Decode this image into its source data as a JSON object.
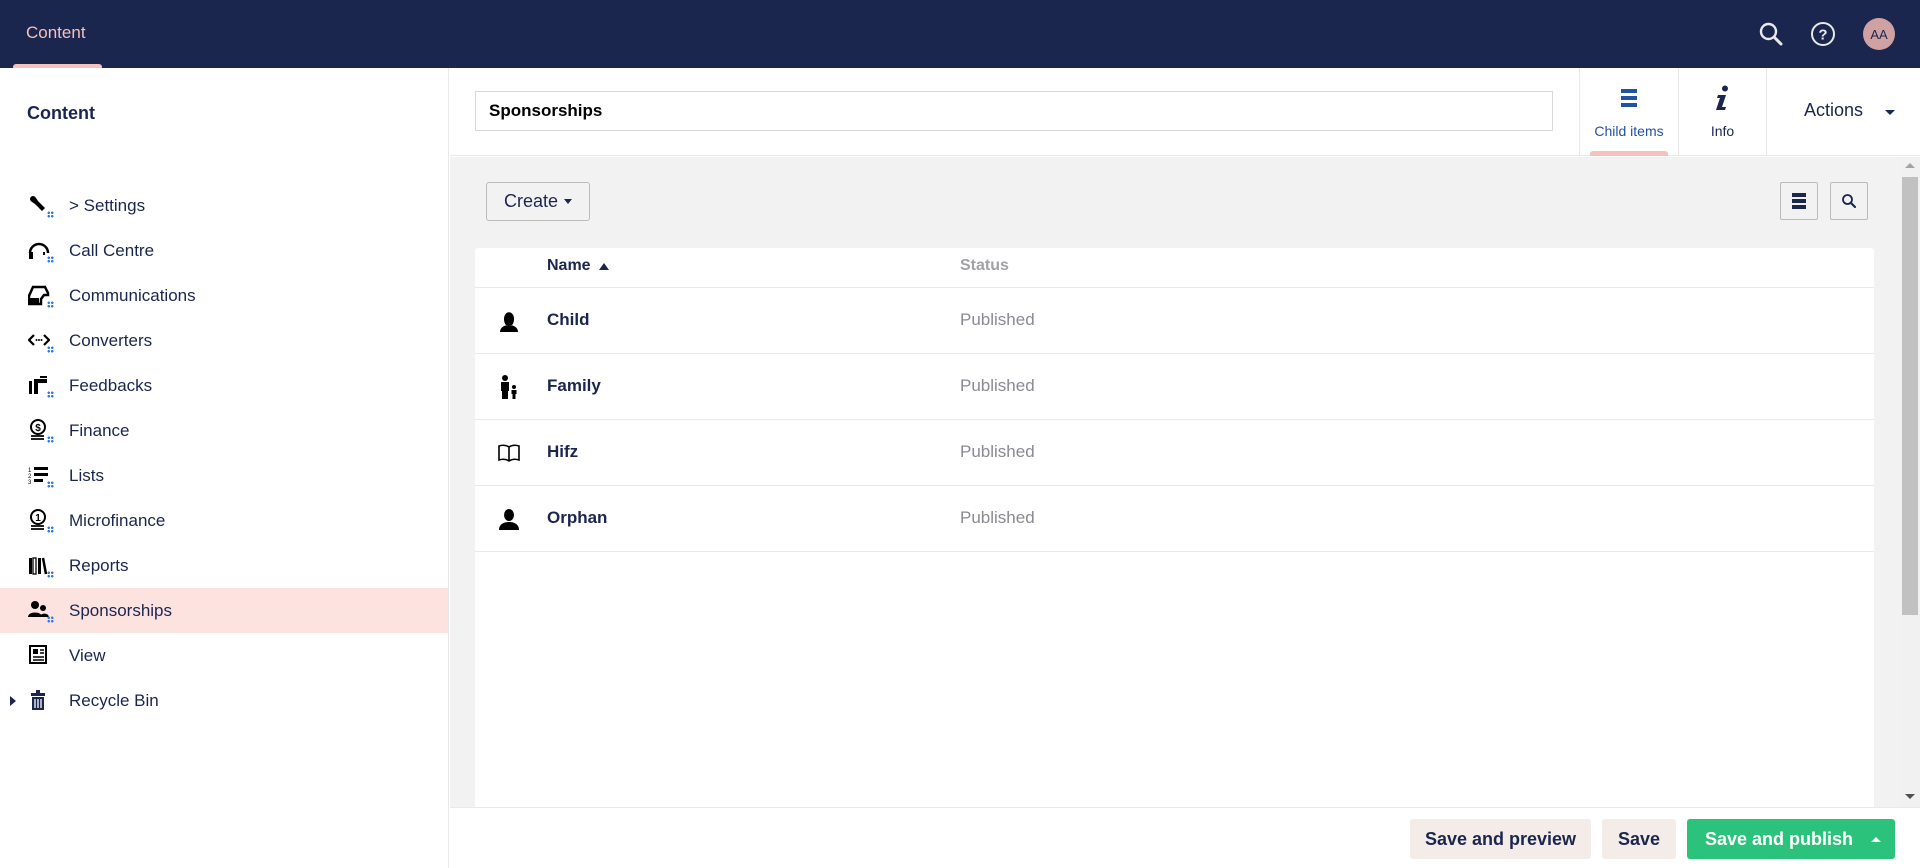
{
  "topbar": {
    "sections": [
      {
        "label": "Content",
        "active": true
      }
    ],
    "icons": [
      "search-icon",
      "help-icon"
    ],
    "avatar_initials": "AA"
  },
  "sidebar": {
    "title": "Content",
    "items": [
      {
        "label": "> Settings",
        "icon": "wrench-icon"
      },
      {
        "label": "Call Centre",
        "icon": "headset-icon"
      },
      {
        "label": "Communications",
        "icon": "inbox-icon"
      },
      {
        "label": "Converters",
        "icon": "code-icon"
      },
      {
        "label": "Feedbacks",
        "icon": "megaphone-icon"
      },
      {
        "label": "Finance",
        "icon": "coins-icon"
      },
      {
        "label": "Lists",
        "icon": "numbered-list-icon"
      },
      {
        "label": "Microfinance",
        "icon": "coin-stack-icon"
      },
      {
        "label": "Reports",
        "icon": "books-icon"
      },
      {
        "label": "Sponsorships",
        "icon": "users-icon",
        "active": true
      },
      {
        "label": "View",
        "icon": "newspaper-icon"
      },
      {
        "label": "Recycle Bin",
        "icon": "trash-icon",
        "expandable": true
      }
    ]
  },
  "editor": {
    "name_value": "Sponsorships",
    "tabs": [
      {
        "label": "Child items",
        "icon": "list-icon",
        "active": true
      },
      {
        "label": "Info",
        "icon": "info-icon"
      }
    ],
    "actions_label": "Actions"
  },
  "listview": {
    "create_label": "Create",
    "columns": {
      "name": "Name",
      "status": "Status"
    },
    "sort": "ascending",
    "rows": [
      {
        "name": "Child",
        "status": "Published",
        "icon": "child-icon"
      },
      {
        "name": "Family",
        "status": "Published",
        "icon": "family-icon"
      },
      {
        "name": "Hifz",
        "status": "Published",
        "icon": "book-icon"
      },
      {
        "name": "Orphan",
        "status": "Published",
        "icon": "user-icon"
      }
    ]
  },
  "footer": {
    "save_preview": "Save and preview",
    "save": "Save",
    "save_publish": "Save and publish"
  },
  "colors": {
    "topbar": "#1b264f",
    "accent": "#f5c1bc",
    "active_item_bg": "#fde3e0",
    "publish_green": "#2bc37c",
    "link_blue": "#2152a3"
  }
}
